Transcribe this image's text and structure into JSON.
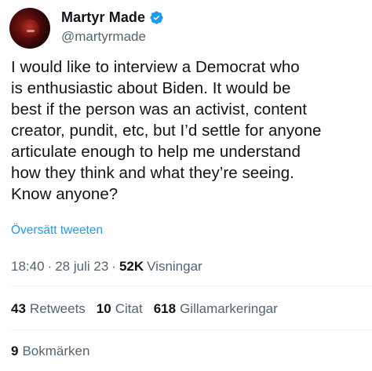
{
  "author": {
    "display_name": "Martyr Made",
    "handle": "@martyrmade",
    "verified": true
  },
  "tweet": {
    "text": "I would like to interview a Democrat who\nis enthusiastic about Biden. It would be\nbest if the person was an activist, content\ncreator, pundit, etc, but I’d settle for anyone\narticulate enough to help me understand\nhow they think and what they’re seeing.\nKnow anyone?",
    "translate_label": "Översätt tweeten"
  },
  "meta": {
    "time": "18:40",
    "sep1": "·",
    "date": "28 juli 23",
    "sep2": "·",
    "views_count": "52K",
    "views_label": "Visningar"
  },
  "stats": {
    "retweets_count": "43",
    "retweets_label": "Retweets",
    "quotes_count": "10",
    "quotes_label": "Citat",
    "likes_count": "618",
    "likes_label": "Gillamarkeringar"
  },
  "bookmarks": {
    "count": "9",
    "label": "Bokmärken"
  },
  "colors": {
    "accent": "#1d9bf0",
    "secondary_text": "#536471",
    "primary_text": "#0f1419",
    "divider": "#eff3f4"
  }
}
